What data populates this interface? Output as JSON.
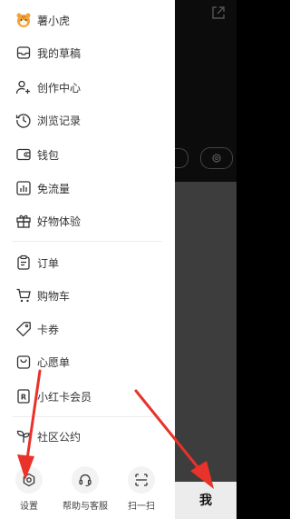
{
  "drawer": {
    "items": [
      {
        "label": "薯小虎",
        "icon": "tiger-avatar-icon"
      },
      {
        "label": "我的草稿",
        "icon": "draft-box-icon"
      },
      {
        "label": "创作中心",
        "icon": "user-plus-icon"
      },
      {
        "label": "浏览记录",
        "icon": "clock-icon"
      },
      {
        "label": "钱包",
        "icon": "wallet-icon"
      },
      {
        "label": "免流量",
        "icon": "data-bars-icon"
      },
      {
        "label": "好物体验",
        "icon": "gift-icon"
      },
      {
        "label": "订单",
        "icon": "clipboard-icon"
      },
      {
        "label": "购物车",
        "icon": "cart-icon"
      },
      {
        "label": "卡券",
        "icon": "coupon-tag-icon"
      },
      {
        "label": "心愿单",
        "icon": "wish-bag-icon"
      },
      {
        "label": "小红卡会员",
        "icon": "member-card-icon"
      },
      {
        "label": "社区公约",
        "icon": "sprout-icon"
      }
    ],
    "bottom": {
      "settings": "设置",
      "help": "帮助与客服",
      "scan": "扫一扫"
    }
  },
  "tabbar": {
    "me": "我"
  },
  "colors": {
    "arrow": "#e8322a",
    "drawer_bg": "#ffffff",
    "overlay": "#000000"
  }
}
